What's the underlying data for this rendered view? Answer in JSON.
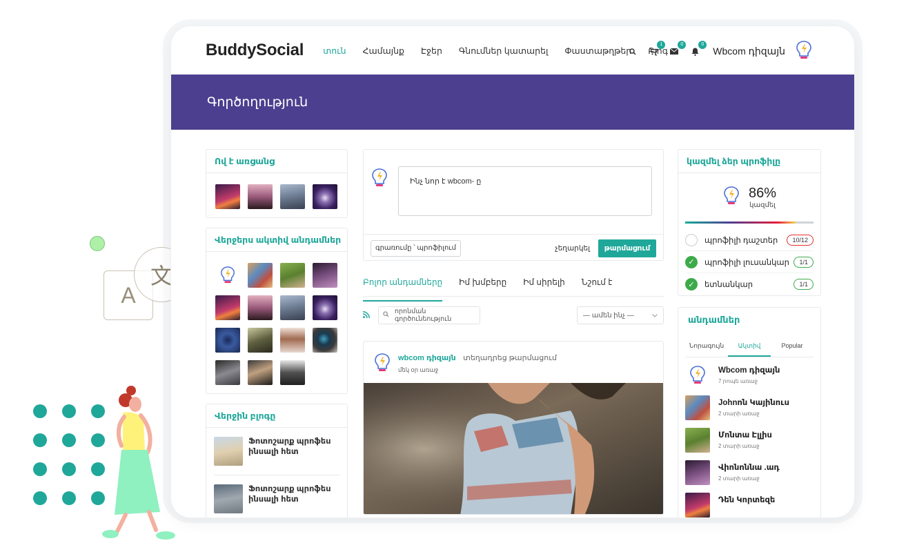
{
  "brand": "BuddySocial",
  "nav": {
    "items": [
      "տուն",
      "Համայնք",
      "Էջեր",
      "Գնումներ կատարել",
      "Փաստաթղթեր",
      "Բլոգ"
    ],
    "active_index": 0
  },
  "header_icons": {
    "cart_count": "1",
    "messages_count": "0",
    "notifications_count": "0",
    "user_name": "Wbcom դիզայն"
  },
  "banner": {
    "title": "Գործողություն"
  },
  "left": {
    "whos_online_title": "Ով է առցանց",
    "recent_members_title": "Վերջերս ակտիվ անդամներ",
    "recent_blog_title": "Վերջին բլոգը",
    "blog_items": [
      {
        "title": "Ֆոտոշարք պրոֆես ինսալի հետ"
      },
      {
        "title": "Ֆոտոշարք պրոֆես ինսալի հետ"
      }
    ]
  },
  "post_form": {
    "placeholder": "Ինչ նոր է wbcom- ը",
    "privacy": "գրառումը ՝ պրոֆիլում",
    "cancel": "չեղարկել",
    "submit": "թարմացում"
  },
  "activity_tabs": [
    "Բոլոր անդամները",
    "Իմ խմբերը",
    "Իմ սիրելի",
    "Նշում է"
  ],
  "filters": {
    "search_placeholder": "որոնման գործունեություն",
    "select_value": "— ամեն ինչ —"
  },
  "activity_item": {
    "user": "wbcom դիզայն",
    "action": "տեղադրեց թարմացում",
    "time": "մեկ օր առաջ"
  },
  "profile_completion": {
    "title": "կազմել ձեր պրոֆիլը",
    "percent": "86%",
    "label": "կազմել",
    "percent_value": 86,
    "rows": [
      {
        "label": "պրոֆիլի դաշտեր",
        "badge": "10/12",
        "done": false
      },
      {
        "label": "պրոֆիլի լուսանկար",
        "badge": "1/1",
        "done": true
      },
      {
        "label": "ետնանկար",
        "badge": "1/1",
        "done": true
      }
    ]
  },
  "members_widget": {
    "title": "անդամներ",
    "tabs": [
      "Նորագույն",
      "Ակտիվ",
      "Popular"
    ],
    "active_tab": 1,
    "items": [
      {
        "name": "Wbcom դիզայն",
        "time": "7 րոպե առաջ"
      },
      {
        "name": "Johnոն Կայինուս",
        "time": "2 տարի առաջ"
      },
      {
        "name": "Մոնտա Էլլիս",
        "time": "2 տարի առաջ"
      },
      {
        "name": "Վիոնոննա .ադ",
        "time": "2 տարի առաջ"
      },
      {
        "name": "Դեն Կորտեզե",
        "time": ""
      }
    ]
  },
  "colors": {
    "accent": "#1fa79a",
    "banner": "#4c3f8f"
  },
  "decor": {
    "translate_box_letter": "A",
    "translate_circle_letter": "文"
  }
}
